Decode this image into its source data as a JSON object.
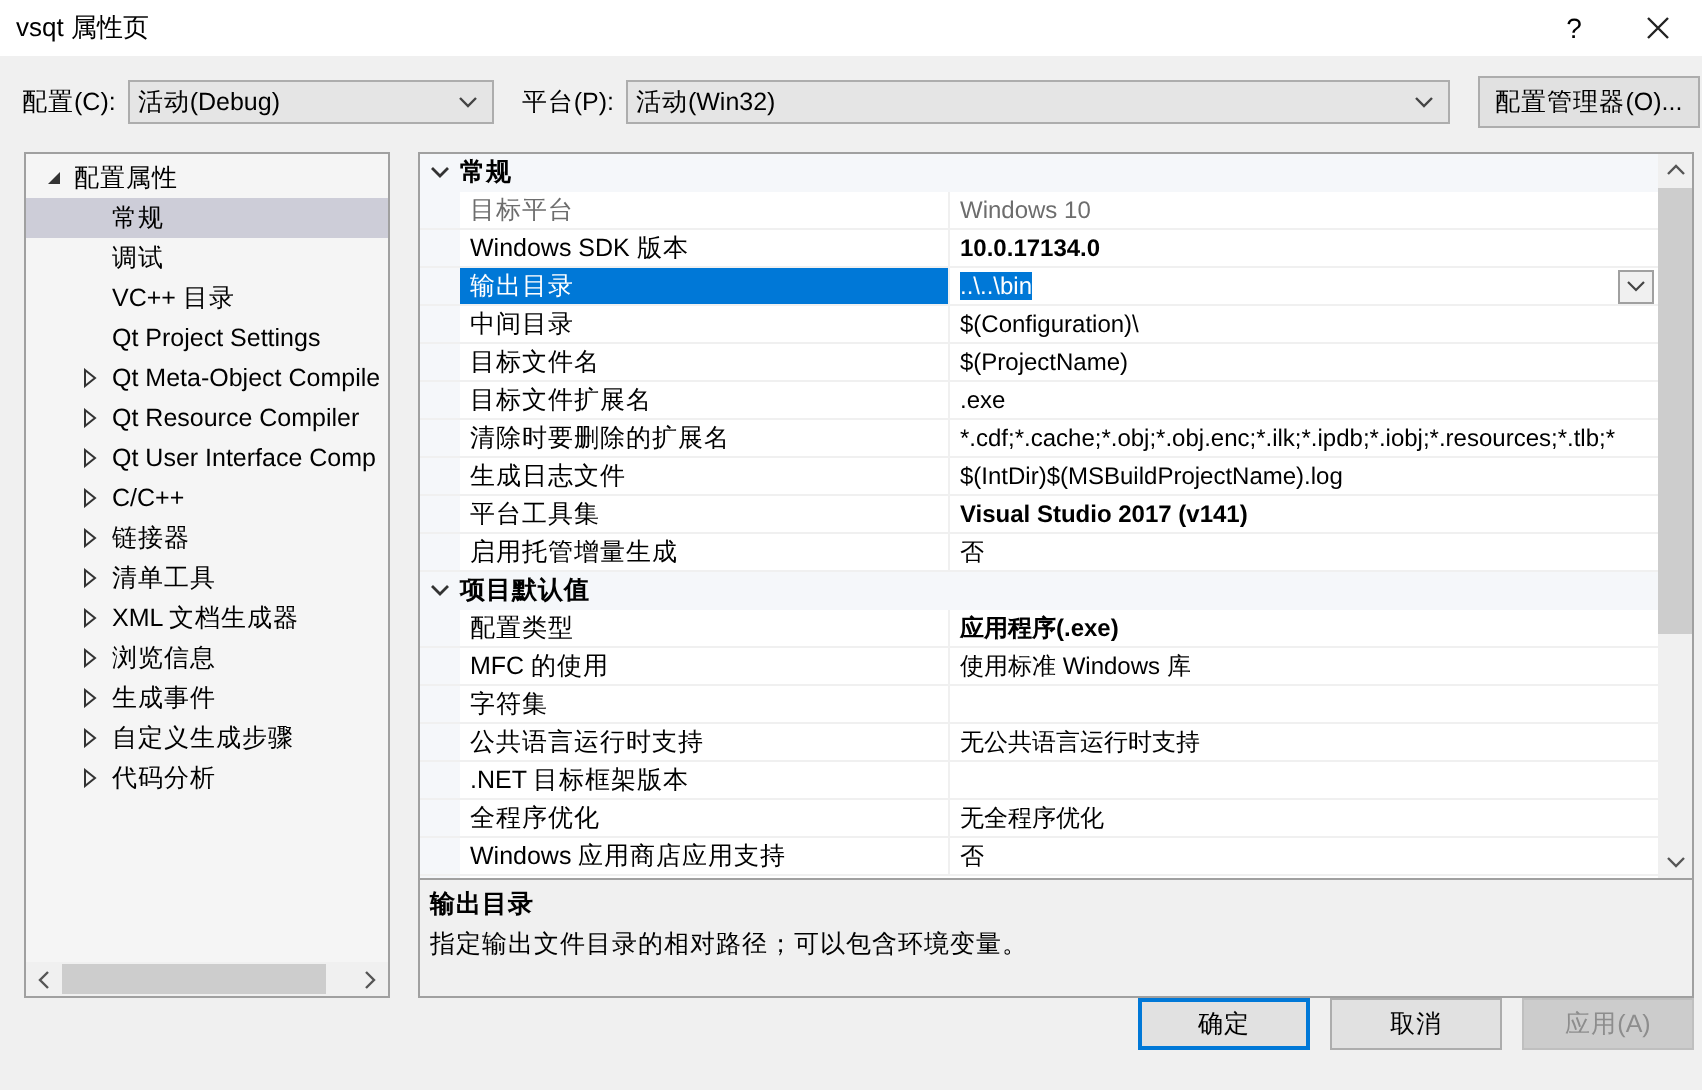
{
  "window": {
    "title": "vsqt 属性页",
    "help_button": "?"
  },
  "toolbar": {
    "configuration": {
      "label": "配置(C):",
      "value": "活动(Debug)"
    },
    "platform": {
      "label": "平台(P):",
      "value": "活动(Win32)"
    },
    "manager_button": "配置管理器(O)..."
  },
  "tree": [
    {
      "label": "配置属性",
      "kind": "folder",
      "expanded": true,
      "selected": false,
      "children": [
        {
          "label": "常规",
          "kind": "leaf",
          "selected": true
        },
        {
          "label": "调试",
          "kind": "leaf",
          "selected": false
        },
        {
          "label": "VC++ 目录",
          "kind": "leaf",
          "selected": false
        },
        {
          "label": "Qt Project Settings",
          "kind": "leaf",
          "selected": false
        },
        {
          "label": "Qt Meta-Object Compile",
          "kind": "folder",
          "expanded": false,
          "selected": false
        },
        {
          "label": "Qt Resource Compiler",
          "kind": "folder",
          "expanded": false,
          "selected": false
        },
        {
          "label": "Qt User Interface Comp",
          "kind": "folder",
          "expanded": false,
          "selected": false
        },
        {
          "label": "C/C++",
          "kind": "folder",
          "expanded": false,
          "selected": false
        },
        {
          "label": "链接器",
          "kind": "folder",
          "expanded": false,
          "selected": false
        },
        {
          "label": "清单工具",
          "kind": "folder",
          "expanded": false,
          "selected": false
        },
        {
          "label": "XML 文档生成器",
          "kind": "folder",
          "expanded": false,
          "selected": false
        },
        {
          "label": "浏览信息",
          "kind": "folder",
          "expanded": false,
          "selected": false
        },
        {
          "label": "生成事件",
          "kind": "folder",
          "expanded": false,
          "selected": false
        },
        {
          "label": "自定义生成步骤",
          "kind": "folder",
          "expanded": false,
          "selected": false
        },
        {
          "label": "代码分析",
          "kind": "folder",
          "expanded": false,
          "selected": false
        }
      ]
    }
  ],
  "properties": [
    {
      "kind": "group",
      "label": "常规",
      "expanded": true
    },
    {
      "kind": "property",
      "name": "目标平台",
      "value": "Windows 10",
      "disabled": true,
      "selected": false
    },
    {
      "kind": "property",
      "name": "Windows SDK 版本",
      "value": "10.0.17134.0",
      "bold": true,
      "disabled": false,
      "selected": false
    },
    {
      "kind": "property",
      "name": "输出目录",
      "value": "..\\..\\bin",
      "disabled": false,
      "selected": true
    },
    {
      "kind": "property",
      "name": "中间目录",
      "value": "$(Configuration)\\",
      "disabled": false,
      "selected": false
    },
    {
      "kind": "property",
      "name": "目标文件名",
      "value": "$(ProjectName)",
      "disabled": false,
      "selected": false
    },
    {
      "kind": "property",
      "name": "目标文件扩展名",
      "value": ".exe",
      "disabled": false,
      "selected": false
    },
    {
      "kind": "property",
      "name": "清除时要删除的扩展名",
      "value": "*.cdf;*.cache;*.obj;*.obj.enc;*.ilk;*.ipdb;*.iobj;*.resources;*.tlb;*",
      "disabled": false,
      "selected": false
    },
    {
      "kind": "property",
      "name": "生成日志文件",
      "value": "$(IntDir)$(MSBuildProjectName).log",
      "disabled": false,
      "selected": false
    },
    {
      "kind": "property",
      "name": "平台工具集",
      "value": "Visual Studio 2017 (v141)",
      "bold": true,
      "disabled": false,
      "selected": false
    },
    {
      "kind": "property",
      "name": "启用托管增量生成",
      "value": "否",
      "disabled": false,
      "selected": false
    },
    {
      "kind": "group",
      "label": "项目默认值",
      "expanded": true
    },
    {
      "kind": "property",
      "name": "配置类型",
      "value": "应用程序(.exe)",
      "bold": true,
      "disabled": false,
      "selected": false
    },
    {
      "kind": "property",
      "name": "MFC 的使用",
      "value": "使用标准 Windows 库",
      "disabled": false,
      "selected": false
    },
    {
      "kind": "property",
      "name": "字符集",
      "disabled": false,
      "selected": false
    },
    {
      "kind": "property",
      "name": "公共语言运行时支持",
      "value": "无公共语言运行时支持",
      "disabled": false,
      "selected": false
    },
    {
      "kind": "property",
      "name": ".NET 目标框架版本",
      "disabled": false,
      "selected": false
    },
    {
      "kind": "property",
      "name": "全程序优化",
      "value": "无全程序优化",
      "disabled": false,
      "selected": false
    },
    {
      "kind": "property",
      "name": "Windows 应用商店应用支持",
      "value": "否",
      "disabled": false,
      "selected": false
    }
  ],
  "description": {
    "title": "输出目录",
    "text": "指定输出文件目录的相对路径；可以包含环境变量。"
  },
  "buttons": [
    {
      "label": "确定",
      "kind": "default",
      "disabled": false
    },
    {
      "label": "取消",
      "kind": "normal",
      "disabled": false
    },
    {
      "label": "应用(A)",
      "kind": "normal",
      "disabled": true
    }
  ]
}
